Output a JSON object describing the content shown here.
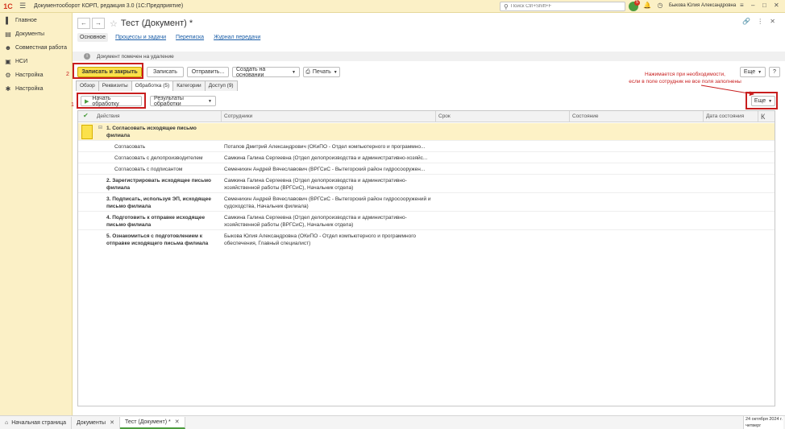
{
  "topbar": {
    "logo": "1С",
    "app_title": "Документооборот КОРП, редакция 3.0  (1С:Предприятие)",
    "search_placeholder": "Поиск Ctrl+Shift+F",
    "notif_count": "5",
    "user": "Быкова Юлия Александровна"
  },
  "sidebar": {
    "items": [
      {
        "label": "Главное",
        "icon": "menu-icon"
      },
      {
        "label": "Документы",
        "icon": "documents-icon"
      },
      {
        "label": "Совместная работа",
        "icon": "people-icon"
      },
      {
        "label": "НСИ",
        "icon": "reference-icon"
      },
      {
        "label": "Настройка",
        "icon": "gear-icon"
      },
      {
        "label": "Настройка",
        "icon": "tools-icon"
      }
    ]
  },
  "document": {
    "title": "Тест (Документ) *",
    "subtabs": [
      "Основное",
      "Процессы и задачи",
      "Переписка",
      "Журнал передачи"
    ],
    "info_message": "Документ помечен на удаление"
  },
  "toolbar": {
    "save_close": "Записать и закрыть",
    "save": "Записать",
    "send": "Отправить...",
    "create_based": "Создать на основании",
    "print": "Печать",
    "more": "Еще",
    "help": "?"
  },
  "tabs": [
    "Обзор",
    "Реквизиты",
    "Обработка (5)",
    "Категории",
    "Доступ (9)"
  ],
  "subtoolbar": {
    "start": "Начать обработку",
    "results": "Результаты обработки",
    "more": "Еще"
  },
  "annotations": {
    "num1": "1",
    "num2": "2",
    "text_line1": "Нажимается при необходимости,",
    "text_line2": "если в поле сотрудник не все поля заполнены"
  },
  "grid": {
    "columns": [
      "Действия",
      "Сотрудники",
      "Срок",
      "Состояние",
      "Дата состояния",
      "К"
    ],
    "rows": [
      {
        "action": "1. Согласовать исходящее письмо филиала",
        "employees": "",
        "bold": true,
        "selected": true,
        "indent": 1
      },
      {
        "action": "Согласовать",
        "employees": "Потапов Дмитрий Александрович (ОКиПО - Отдел компьютерного и программно...",
        "bold": false,
        "indent": 2
      },
      {
        "action": "Согласовать с делопроизводителем",
        "employees": "Самкина Галина Сергеевна (Отдел делопроизводства и административно-хозяйс...",
        "bold": false,
        "indent": 2
      },
      {
        "action": "Согласовать с подписантом",
        "employees": "Семенихин Андрей Вячеславович (ВРГСиС - Вытегорский район гидросооружен...",
        "bold": false,
        "indent": 2
      },
      {
        "action": "2. Зарегистрировать исходящее письмо филиала",
        "employees": "Самкина Галина Сергеевна (Отдел делопроизводства и административно-хозяйственной работы (ВРГСиС), Начальник отдела)",
        "bold": true,
        "indent": 1
      },
      {
        "action": "3. Подписать, используя ЭП, исходящее письмо филиала",
        "employees": "Семенихин Андрей Вячеславович (ВРГСиС - Вытегорский район гидросооружений и судоходства, Начальник филиала)",
        "bold": true,
        "indent": 1
      },
      {
        "action": "4. Подготовить к отправке исходящее письмо филиала",
        "employees": "Самкина Галина Сергеевна (Отдел делопроизводства и административно-хозяйственной работы (ВРГСиС), Начальник отдела)",
        "bold": true,
        "indent": 1
      },
      {
        "action": "5. Ознакомиться с подготовлением к отправке исходящего письма филиала",
        "employees": "Быкова Юлия Александровна (ОКиПО - Отдел компьютерного и программного обеспечения, Главный специалист)",
        "bold": true,
        "indent": 1
      }
    ]
  },
  "bottombar": {
    "tabs": [
      "Начальная страница",
      "Документы",
      "Тест (Документ) *"
    ],
    "date": "24 октября 2024 г.",
    "weekday": "четверг"
  }
}
